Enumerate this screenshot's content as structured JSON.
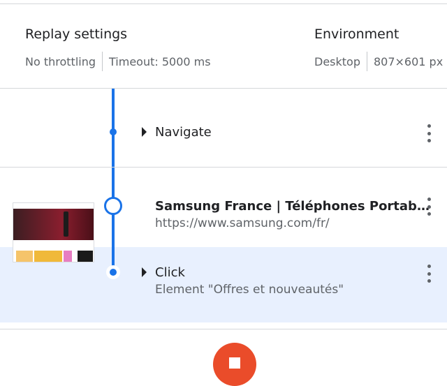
{
  "settings": {
    "replay": {
      "heading": "Replay settings",
      "throttling": "No throttling",
      "timeout": "Timeout: 5000 ms"
    },
    "environment": {
      "heading": "Environment",
      "device": "Desktop",
      "viewport": "807×601 px"
    }
  },
  "steps": [
    {
      "type": "Navigate"
    },
    {
      "title": "Samsung France | Téléphones Portab…",
      "url": "https://www.samsung.com/fr/"
    },
    {
      "type": "Click",
      "detail": "Element \"Offres et nouveautés\""
    }
  ],
  "colors": {
    "accent": "#1a73e8",
    "highlight": "#e8f0fe",
    "stop": "#ea4c2a"
  },
  "icons": {
    "menu": "more-vert-icon",
    "expand": "triangle-right-icon",
    "stop": "stop-icon"
  }
}
